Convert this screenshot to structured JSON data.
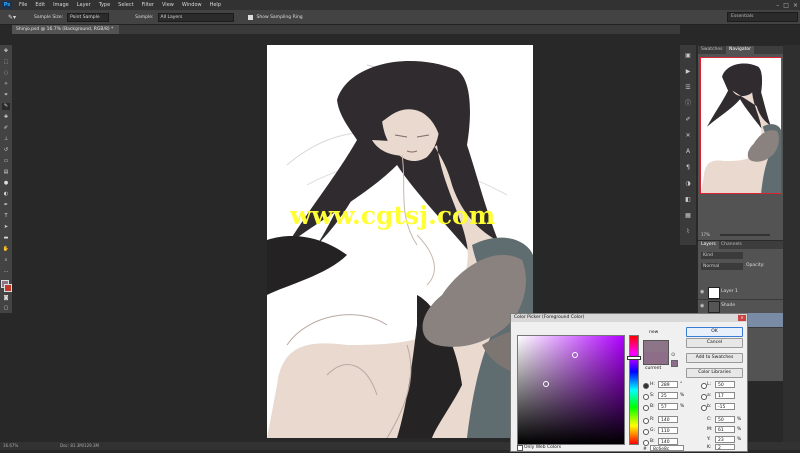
{
  "menubar": {
    "logo": "Ps",
    "items": [
      "File",
      "Edit",
      "Image",
      "Layer",
      "Type",
      "Select",
      "Filter",
      "View",
      "Window",
      "Help"
    ]
  },
  "optionsbar": {
    "sample_size_label": "Sample Size:",
    "sample_size_value": "Point Sample",
    "sample_label": "Sample:",
    "sample_value": "All Layers",
    "show_ring_label": "Show Sampling Ring"
  },
  "workspace": "Essentials",
  "document_tab": "Shinjo.psd @ 16.7% (Background, RGB/8) *",
  "watermark": "www.cgtsj.com",
  "statusbar": {
    "zoom": "16.67%",
    "doc": "Doc: 81.3M/129.3M"
  },
  "navigator": {
    "tabs": [
      "Swatches",
      "Navigator"
    ],
    "zoom": "17%"
  },
  "layers": {
    "tabs": [
      "Layers",
      "Channels"
    ],
    "kind": "Kind",
    "blend": "Normal",
    "opacity_label": "Opacity:",
    "items": [
      {
        "name": "Layer 1",
        "selected": false
      },
      {
        "name": "Shade",
        "selected": false
      },
      {
        "name": "",
        "selected": true
      }
    ]
  },
  "color_picker": {
    "title": "Color Picker (Foreground Color)",
    "new_label": "new",
    "current_label": "current",
    "buttons": {
      "ok": "OK",
      "cancel": "Cancel",
      "add_swatches": "Add to Swatches",
      "libraries": "Color Libraries"
    },
    "hsb": {
      "H": "289",
      "S": "25",
      "B": "57"
    },
    "hsb_units": {
      "H": "°",
      "S": "%",
      "B": "%"
    },
    "rgb": {
      "R": "140",
      "G": "110",
      "B": "140"
    },
    "lab": {
      "L": "50",
      "a": "17",
      "b": "-15"
    },
    "cmyk": {
      "C": "50",
      "M": "61",
      "Y": "23",
      "K": "2"
    },
    "hex_label": "#",
    "hex": "8c6e8c",
    "only_web_colors": "Only Web Colors",
    "selected_hue": "#b000ff"
  }
}
